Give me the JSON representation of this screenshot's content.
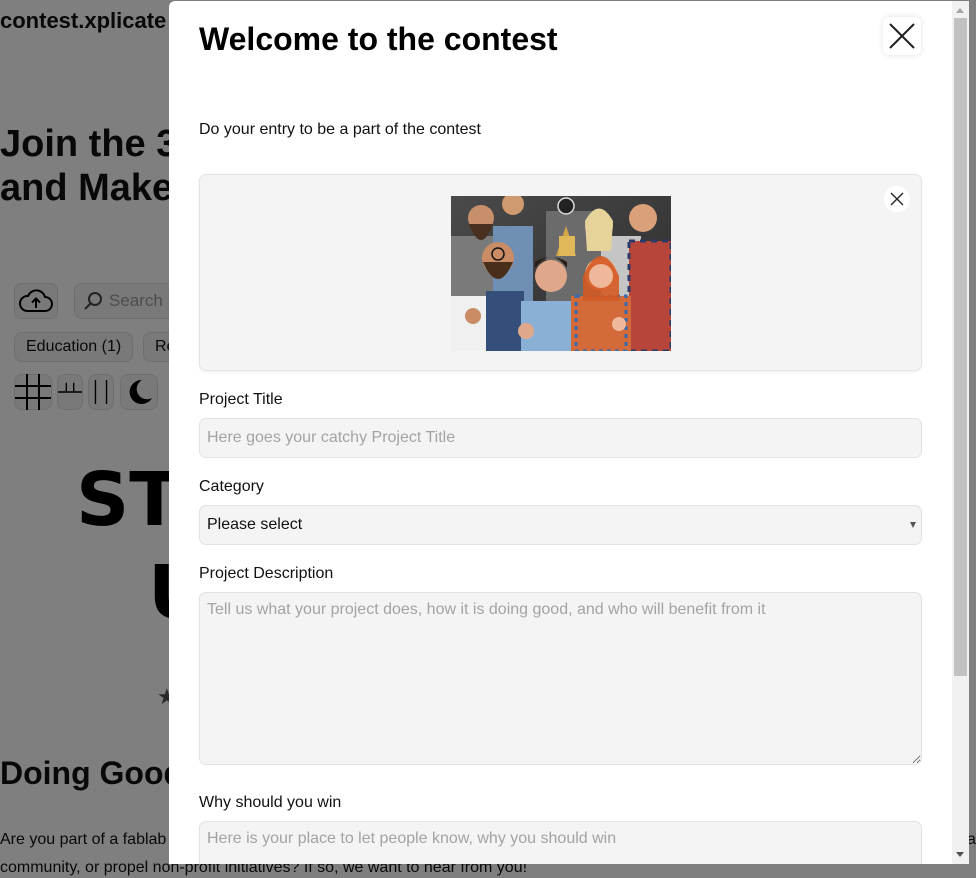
{
  "background_page": {
    "site_name": "contest.xplicate",
    "hero_title_line1": "Join the 3",
    "hero_title_line2": "and Make",
    "search": {
      "placeholder": "Search",
      "icon": "search-icon"
    },
    "upload_icon": "cloud-upload-icon",
    "filter_chips": [
      {
        "label": "Education  (1)"
      },
      {
        "label": "Re"
      }
    ],
    "view_buttons": [
      {
        "icon": "grid-view-icon"
      },
      {
        "icon": "masonry-view-icon"
      },
      {
        "icon": "column-view-icon"
      },
      {
        "icon": "dark-mode-moon-icon"
      }
    ],
    "logo_text_line1": "STA",
    "logo_text_line2": "U",
    "star_icon": "star-icon",
    "section_title": "Doing Good",
    "section_text_line1": "Are you part of a fablab",
    "section_text_line2": "community, or propel non-profit initiatives? If so, we want to hear from you!",
    "section_text_trailing": "a"
  },
  "modal": {
    "title": "Welcome to the contest",
    "close_icon": "close-icon",
    "intro": "Do your entry to be a part of the contest",
    "image_upload": {
      "image_alt": "Group of smiling makers giving thumbs up in a workshop",
      "remove_icon": "close-icon"
    },
    "fields": {
      "project_title": {
        "label": "Project Title",
        "value": "",
        "placeholder": "Here goes your catchy Project Title"
      },
      "category": {
        "label": "Category",
        "selected": "Please select"
      },
      "project_description": {
        "label": "Project Description",
        "value": "",
        "placeholder": "Tell us what your project does, how it is doing good, and who will benefit from it"
      },
      "why_win": {
        "label": "Why should you win",
        "value": "",
        "placeholder": "Here is your place to let people know, why you should win"
      }
    }
  },
  "colors": {
    "overlay": "#808080",
    "field_bg": "#f4f4f4",
    "placeholder": "#a3a3a3",
    "scrollbar_thumb": "#c1c1c1"
  }
}
